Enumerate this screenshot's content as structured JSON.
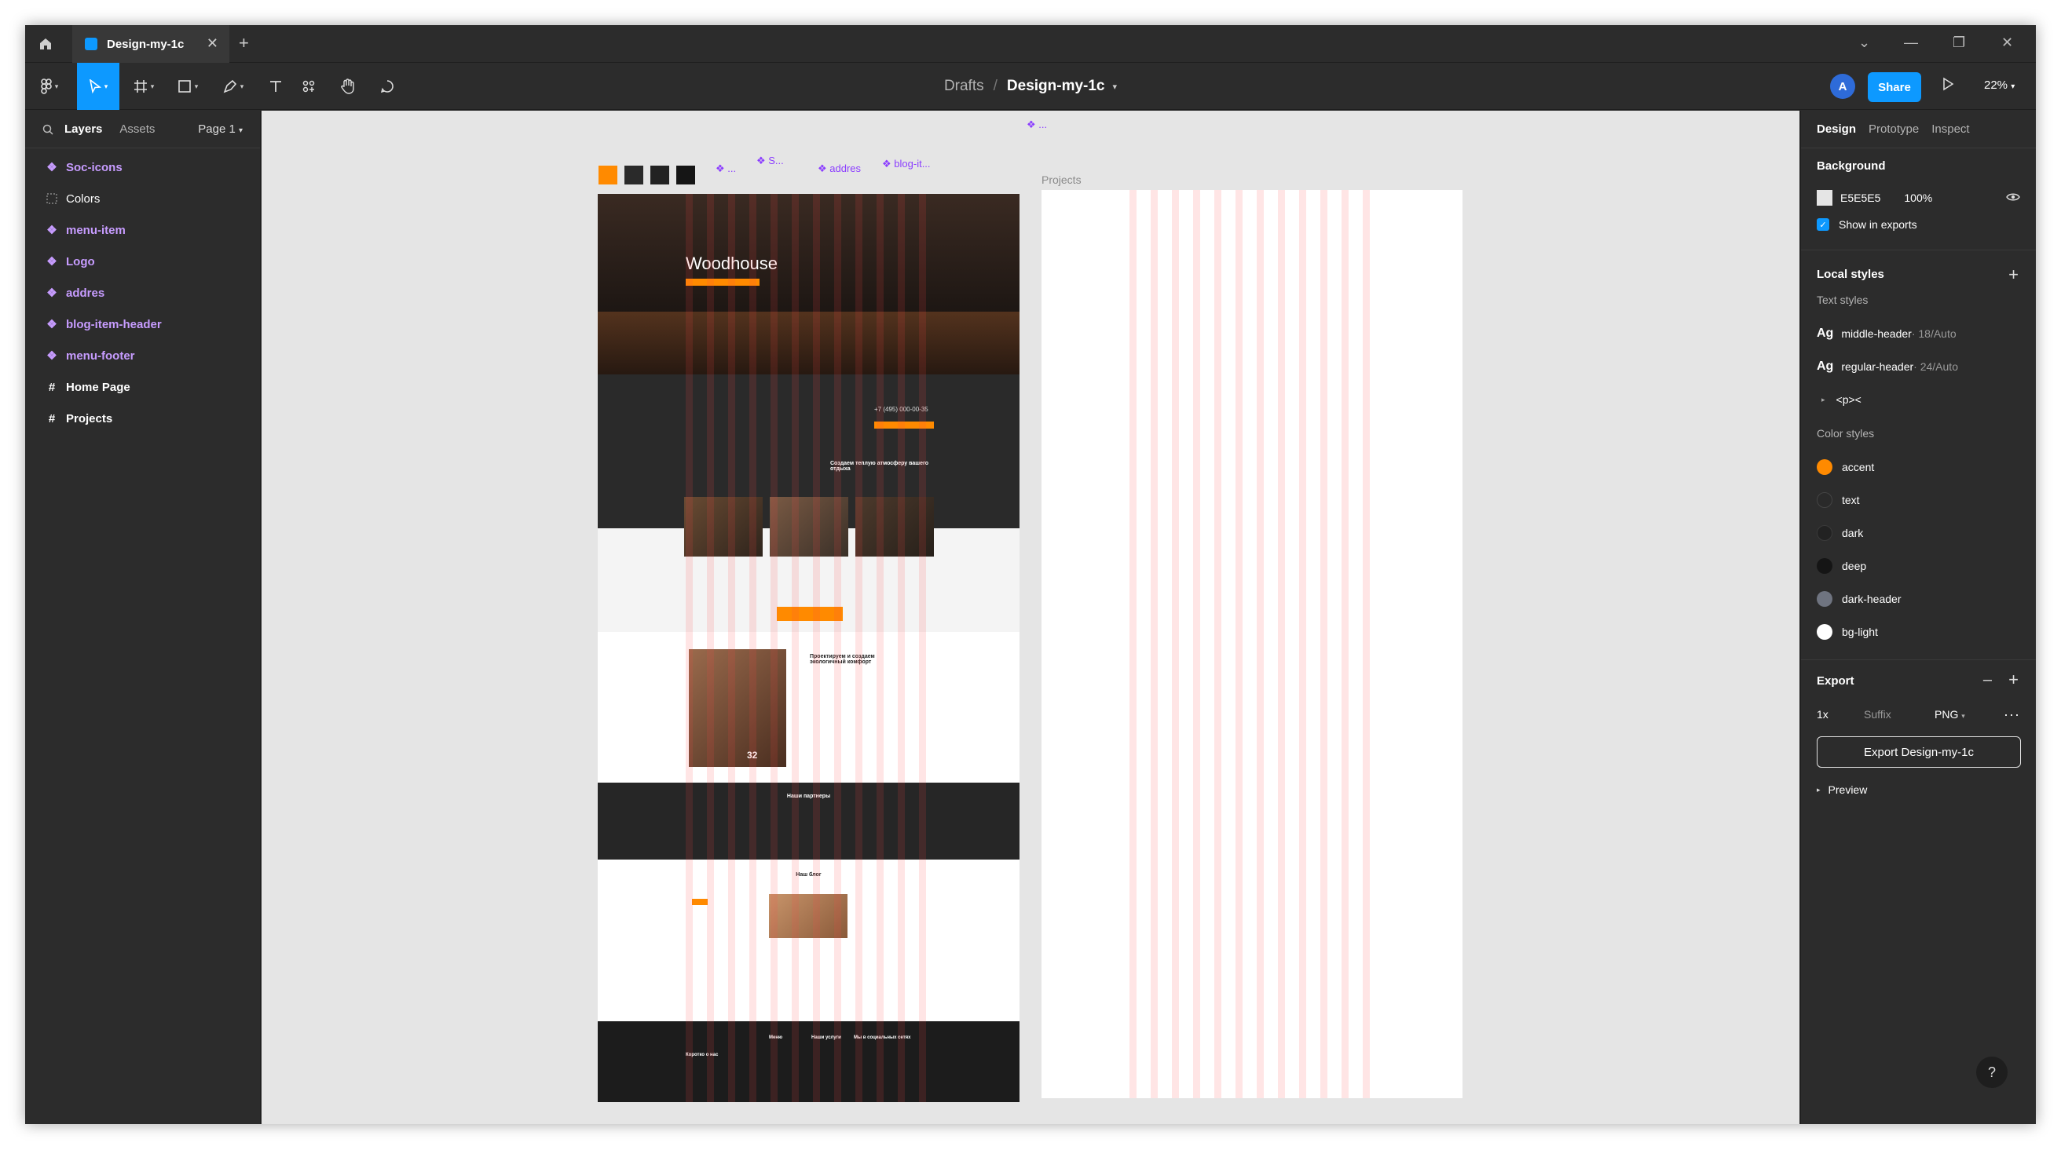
{
  "tab": {
    "title": "Design-my-1c"
  },
  "breadcrumb": {
    "parent": "Drafts",
    "file": "Design-my-1c"
  },
  "toolbar": {
    "share_label": "Share",
    "zoom": "22%",
    "avatar_initial": "A"
  },
  "left_panel": {
    "tabs": [
      "Layers",
      "Assets"
    ],
    "page": "Page 1",
    "layers": [
      {
        "label": "Soc-icons",
        "kind": "component"
      },
      {
        "label": "Colors",
        "kind": "group"
      },
      {
        "label": "menu-item",
        "kind": "component"
      },
      {
        "label": "Logo",
        "kind": "component"
      },
      {
        "label": "addres",
        "kind": "component"
      },
      {
        "label": "blog-item-header",
        "kind": "component"
      },
      {
        "label": "menu-footer",
        "kind": "component"
      },
      {
        "label": "Home Page",
        "kind": "frame"
      },
      {
        "label": "Projects",
        "kind": "frame"
      }
    ]
  },
  "canvas": {
    "frame_labels": {
      "projects": "Projects"
    },
    "component_labels": [
      "addres",
      "blog-it..."
    ],
    "home": {
      "hero_title": "Woodhouse",
      "phone": "+7 (495) 000-00-35",
      "section_heading": "Создаем теплую атмосферу вашего отдыха",
      "about_heading": "Проектируем и создаем экологичный комфорт",
      "stat": "32",
      "partners_heading": "Наши партнеры",
      "blog_heading": "Наш блог",
      "footer_about": "Коротко о нас",
      "footer_menu": "Меню",
      "footer_services": "Наши услуги",
      "footer_social": "Мы в социальных сетях"
    }
  },
  "right_panel": {
    "tabs": [
      "Design",
      "Prototype",
      "Inspect"
    ],
    "background": {
      "title": "Background",
      "hex": "E5E5E5",
      "opacity": "100%",
      "show_in_exports": "Show in exports"
    },
    "local_styles": {
      "title": "Local styles",
      "text_styles_title": "Text styles",
      "text_styles": [
        {
          "name": "middle-header",
          "meta": " · 18/Auto"
        },
        {
          "name": "regular-header",
          "meta": " · 24/Auto"
        }
      ],
      "group": "<p><",
      "color_styles_title": "Color styles",
      "color_styles": [
        {
          "name": "accent",
          "color": "#ff8a00"
        },
        {
          "name": "text",
          "color": "#2a2a2a"
        },
        {
          "name": "dark",
          "color": "#222222"
        },
        {
          "name": "deep",
          "color": "#151515"
        },
        {
          "name": "dark-header",
          "color": "#6f7480"
        },
        {
          "name": "bg-light",
          "color": "#ffffff"
        }
      ]
    },
    "export": {
      "title": "Export",
      "scale": "1x",
      "suffix_placeholder": "Suffix",
      "format": "PNG",
      "button": "Export Design-my-1c",
      "preview": "Preview"
    }
  },
  "colors": {
    "accent": "#0d99ff",
    "component": "#c79cff"
  }
}
